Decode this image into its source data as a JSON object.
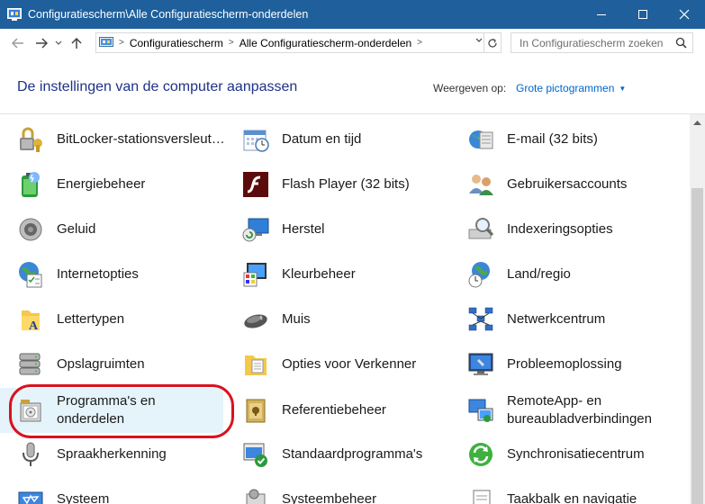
{
  "window": {
    "title": "Configuratiescherm\\Alle Configuratiescherm-onderdelen"
  },
  "address": {
    "crumbs": [
      "Configuratiescherm",
      "Alle Configuratiescherm-onderdelen"
    ]
  },
  "search": {
    "placeholder": "In Configuratiescherm zoeken"
  },
  "header": {
    "title": "De instellingen van de computer aanpassen",
    "view_label": "Weergeven op:",
    "view_value": "Grote pictogrammen"
  },
  "items": [
    [
      "BitLocker-stationsversleut…",
      "Datum en tijd",
      "E-mail (32 bits)"
    ],
    [
      "Energiebeheer",
      "Flash Player (32 bits)",
      "Gebruikersaccounts"
    ],
    [
      "Geluid",
      "Herstel",
      "Indexeringsopties"
    ],
    [
      "Internetopties",
      "Kleurbeheer",
      "Land/regio"
    ],
    [
      "Lettertypen",
      "Muis",
      "Netwerkcentrum"
    ],
    [
      "Opslagruimten",
      "Opties voor Verkenner",
      "Probleemoplossing"
    ],
    [
      "Programma's en onderdelen",
      "Referentiebeheer",
      "RemoteApp- en bureaubladverbindingen"
    ],
    [
      "Spraakherkenning",
      "Standaardprogramma's",
      "Synchronisatiecentrum"
    ],
    [
      "Systeem",
      "Systeembeheer",
      "Taakbalk en navigatie"
    ]
  ],
  "colors": {
    "titlebar": "#1e5f9c",
    "title_text": "#1e3287",
    "link": "#0066cc",
    "highlight": "#d9121e"
  }
}
